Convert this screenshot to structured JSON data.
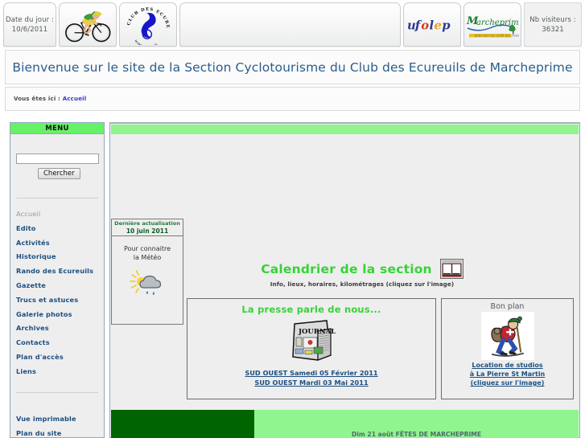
{
  "header": {
    "date_label": "Date du jour :",
    "date_value": "10/6/2011",
    "visitors_label": "Nb visiteurs :",
    "visitors_value": "36321",
    "logo_club_alt": "CLUB DES ECUREUILS",
    "logo_ufolep_alt": "ufolep",
    "logo_marcheprime_alt": "Marcheprime"
  },
  "welcome": {
    "title": "Bienvenue sur le site de la Section Cyclotourisme du Club des Ecureuils de Marcheprime"
  },
  "breadcrumb": {
    "prefix": "Vous êtes ici :",
    "current": "Accueil"
  },
  "sidebar": {
    "title": "MENU",
    "search": {
      "value": "",
      "placeholder": "",
      "button_label": "Chercher"
    },
    "items": [
      {
        "label": "Accueil",
        "current": true
      },
      {
        "label": "Edito",
        "current": false
      },
      {
        "label": "Activités",
        "current": false
      },
      {
        "label": "Historique",
        "current": false
      },
      {
        "label": "Rando des Ecureuils",
        "current": false
      },
      {
        "label": "Gazette",
        "current": false
      },
      {
        "label": "Trucs et astuces",
        "current": false
      },
      {
        "label": "Galerie photos",
        "current": false
      },
      {
        "label": "Archives",
        "current": false
      },
      {
        "label": "Contacts",
        "current": false
      },
      {
        "label": "Plan d'accès",
        "current": false
      },
      {
        "label": "Liens",
        "current": false
      }
    ],
    "items_secondary": [
      {
        "label": "Vue imprimable"
      },
      {
        "label": "Plan du site"
      }
    ]
  },
  "content": {
    "weather": {
      "update_label": "Dernière actualisation",
      "update_date": "10 juin 2011",
      "line1": "Pour connaitre",
      "line2": "la Météo",
      "icon": "sun-cloud-rain-icon"
    },
    "calendar": {
      "title": "Calendrier de la section",
      "subtitle": "Info, lieux, horaires, kilométrages (cliquez sur l'image)",
      "icon": "open-book-icon"
    },
    "press": {
      "title": "La presse parle de nous...",
      "image_alt": "journal-icon",
      "links": [
        "SUD OUEST Samedi 05 Février 2011",
        "SUD OUEST Mardi 03 Mai 2011"
      ]
    },
    "bonplan": {
      "title": "Bon plan",
      "image_alt": "hiker-icon",
      "links": [
        "Location de studios",
        "à La Pierre St Martin",
        "(cliquez sur l'image)"
      ]
    },
    "bottom_event": "Dim 21 août FÊTES DE MARCHEPRIME"
  },
  "colors": {
    "light_green": "#90f48f",
    "menu_green": "#66f266",
    "dark_green": "#006400",
    "title_blue": "#2b5d8c",
    "link_blue": "#1d4f80",
    "accent_green": "#35d435"
  }
}
